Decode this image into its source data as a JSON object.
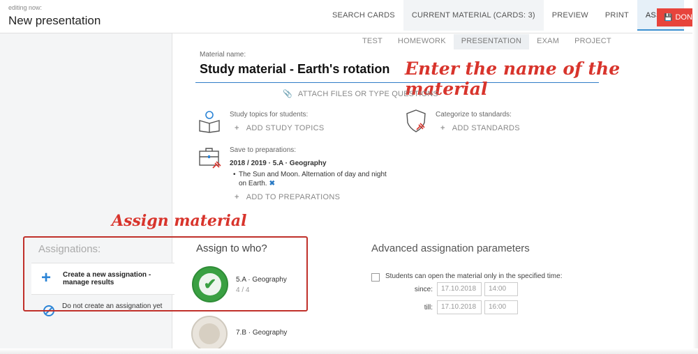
{
  "header": {
    "editing_label": "editing now:",
    "doc_title": "New presentation",
    "nav": [
      "SEARCH CARDS",
      "CURRENT MATERIAL (CARDS: 3)",
      "PREVIEW",
      "PRINT",
      "ASSIGN"
    ],
    "active_nav": "ASSIGN",
    "done_label": "DONE",
    "done_icon": "save-icon"
  },
  "subtabs": [
    "TEST",
    "HOMEWORK",
    "PRESENTATION",
    "EXAM",
    "PROJECT"
  ],
  "active_subtab": "PRESENTATION",
  "material": {
    "label": "Material name:",
    "name": "Study material - Earth's rotation",
    "attach_label": "ATTACH FILES OR TYPE QUESTIONS"
  },
  "annotations": {
    "name_hint": "Enter the name of the material",
    "assign_hint": "Assign material"
  },
  "study_topics": {
    "label": "Study topics for students:",
    "add_label": "ADD STUDY TOPICS"
  },
  "standards": {
    "label": "Categorize to standards:",
    "add_label": "ADD STANDARDS"
  },
  "preparations": {
    "label": "Save to preparations:",
    "year_class": "2018 / 2019 · 5.A · Geography",
    "item": "The Sun and Moon. Alternation of day and night on Earth.",
    "add_label": "ADD TO PREPARATIONS"
  },
  "assignations": {
    "title": "Assignations:",
    "create_label": "Create a new assignation - manage results",
    "no_label": "Do not create an assignation yet"
  },
  "assign_to": {
    "title": "Assign to who?",
    "classes": [
      {
        "name": "5.A · Geography",
        "count": "4 / 4",
        "selected": true
      },
      {
        "name": "7.B · Geography",
        "count": "",
        "selected": false
      }
    ]
  },
  "advanced": {
    "title": "Advanced assignation parameters",
    "checkbox_label": "Students can open the material only in the specified time:",
    "since_label": "since:",
    "since_date": "17.10.2018",
    "since_time": "14:00",
    "till_label": "till:",
    "till_date": "17.10.2018",
    "till_time": "16:00"
  },
  "colors": {
    "accent": "#2b84d6",
    "annotation": "#d8342c",
    "done": "#e7443c",
    "selected_class": "#3aa042"
  }
}
